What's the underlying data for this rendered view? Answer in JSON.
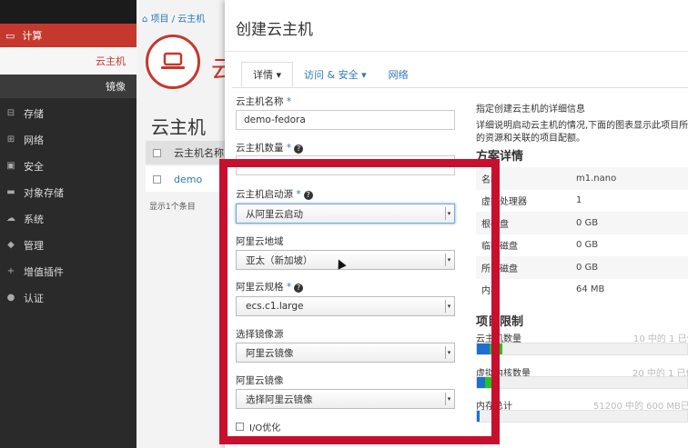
{
  "sidebar": {
    "compute": "计算",
    "sub_items": [
      "云主机",
      "镜像"
    ],
    "items": [
      {
        "icon": "hdd-icon",
        "label": "存储"
      },
      {
        "icon": "network-icon",
        "label": "网络"
      },
      {
        "icon": "lock-icon",
        "label": "安全"
      },
      {
        "icon": "folder-icon",
        "label": "对象存储"
      },
      {
        "icon": "cloud-icon",
        "label": "系统"
      },
      {
        "icon": "graduation-cap-icon",
        "label": "管理"
      },
      {
        "icon": "plus-icon",
        "label": "增值插件"
      },
      {
        "icon": "user-icon",
        "label": "认证"
      }
    ]
  },
  "page": {
    "breadcrumb": "项目 / 云主机",
    "logo_letter": "云",
    "title": "云主机",
    "table_header": "云主机名称",
    "row_name": "demo",
    "footer": "显示1个条目"
  },
  "modal": {
    "title": "创建云主机",
    "tabs": [
      "详情 ▾",
      "访问 & 安全 ▾",
      "网络"
    ],
    "fields": {
      "name_label": "云主机名称",
      "name_value": "demo-fedora",
      "count_label": "云主机数量",
      "boot_label": "云主机启动源",
      "boot_value": "从阿里云启动",
      "region_label": "阿里云地域",
      "region_value": "亚太（新加坡）",
      "spec_label": "阿里云规格",
      "spec_value": "ecs.c1.large",
      "image_source_label": "选择镜像源",
      "image_source_value": "阿里云镜像",
      "image_label": "阿里云镜像",
      "image_value": "选择阿里云镜像",
      "io_label": "I/O优化"
    },
    "right": {
      "intro1": "指定创建云主机的详细信息",
      "intro2": "详细说明启动云主机的情况,下面的图表显示此项目所使用",
      "intro3": "的资源和关联的项目配额。",
      "flavor_title": "方案详情",
      "flavor_rows": [
        {
          "k": "名称",
          "v": "m1.nano"
        },
        {
          "k": "虚拟处理器",
          "v": "1"
        },
        {
          "k": "根磁盘",
          "v": "0 GB"
        },
        {
          "k": "临时磁盘",
          "v": "0 GB"
        },
        {
          "k": "所有磁盘",
          "v": "0 GB"
        },
        {
          "k": "内存",
          "v": "64 MB"
        }
      ],
      "quota_title": "项目限制",
      "quotas": [
        {
          "label": "云主机数量",
          "info": "10 中的 1 已使",
          "used": 0.06,
          "add": 0.06
        },
        {
          "label": "虚拟内核数量",
          "info": "20 中的 1 已使",
          "used": 0.04,
          "add": 0.05
        },
        {
          "label": "内存总计",
          "info": "51200 中的 600 MB已使",
          "used": 0.012,
          "add": 0.0
        }
      ]
    }
  },
  "colors": {
    "accent": "#c5382e",
    "link": "#2a7ab8",
    "highlight": "#c8102e"
  }
}
